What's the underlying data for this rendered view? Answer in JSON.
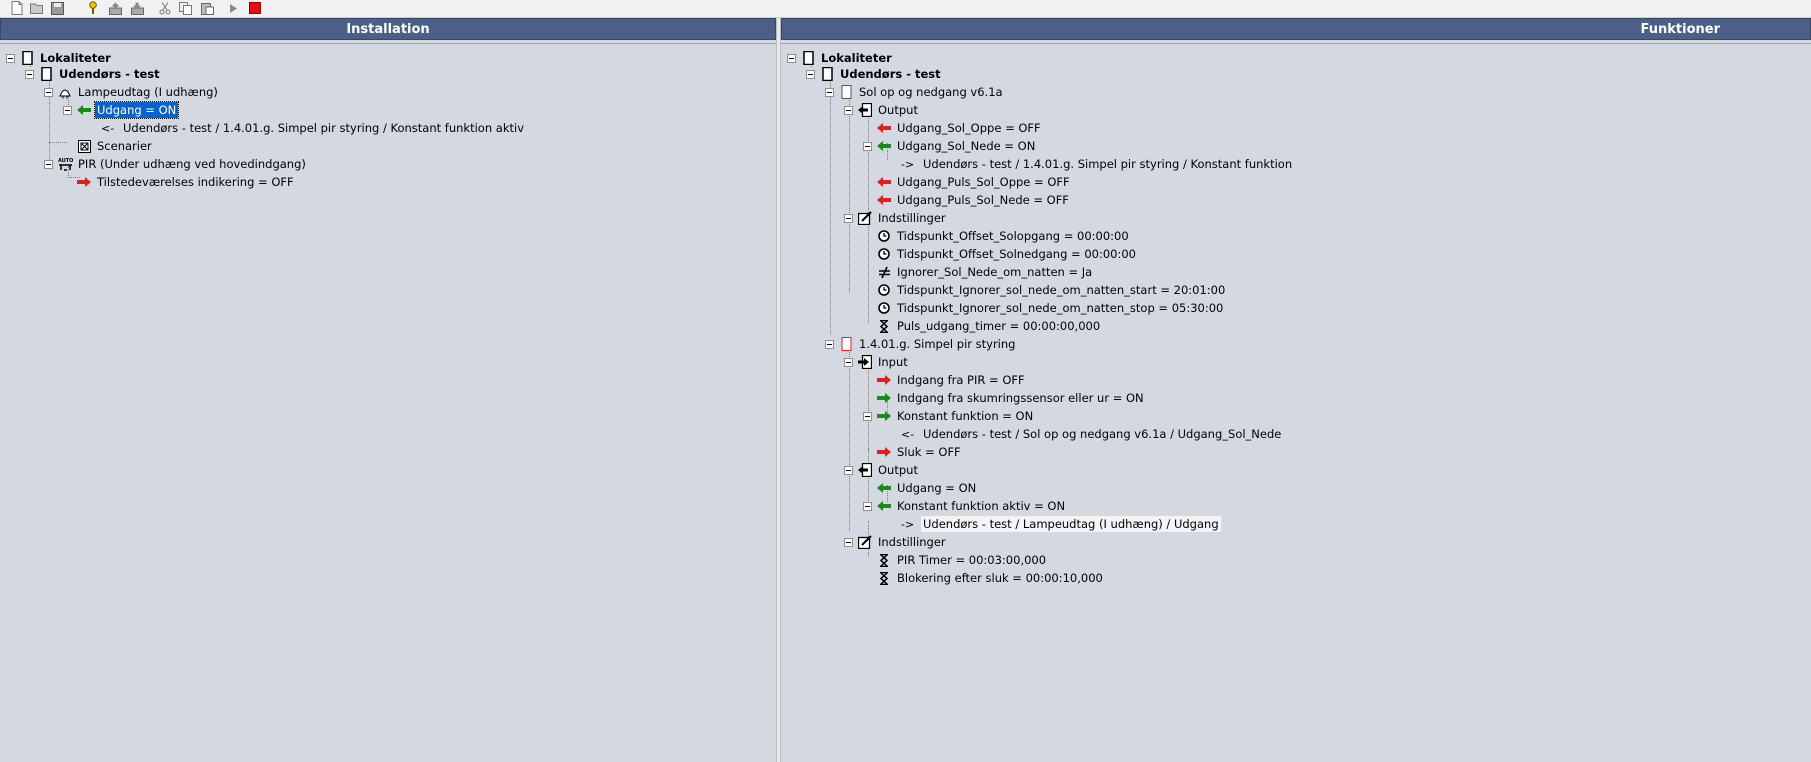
{
  "toolbar": {
    "buttons": [
      {
        "name": "new-document-icon"
      },
      {
        "name": "open-folder-icon"
      },
      {
        "name": "save-icon"
      },
      {
        "name": "key-icon"
      },
      {
        "name": "upload-icon"
      },
      {
        "name": "download-icon"
      },
      {
        "name": "cut-icon"
      },
      {
        "name": "copy-icon"
      },
      {
        "name": "paste-icon"
      },
      {
        "name": "play-icon"
      },
      {
        "name": "stop-icon"
      }
    ]
  },
  "installation": {
    "title": "Installation",
    "root": "Lokaliteter",
    "location": "Udendørs - test",
    "lamp": "Lampeudtag (I udhæng)",
    "lamp_output": "Udgang = ON",
    "lamp_output_ref_arrow": "<-",
    "lamp_output_ref": "Udendørs - test / 1.4.01.g. Simpel pir styring / Konstant funktion aktiv",
    "scenarios": "Scenarier",
    "pir": "PIR (Under udhæng ved hovedindgang)",
    "pir_output": "Tilstedeværelses indikering = OFF"
  },
  "functions": {
    "title": "Funktioner",
    "root": "Lokaliteter",
    "location": "Udendørs - test",
    "sun": {
      "name": "Sol op og nedgang v6.1a",
      "output_group": "Output",
      "outputs": [
        "Udgang_Sol_Oppe = OFF",
        "Udgang_Sol_Nede = ON",
        "Udgang_Puls_Sol_Oppe = OFF",
        "Udgang_Puls_Sol_Nede = OFF"
      ],
      "output_ref_arrow": "->",
      "output_ref": "Udendørs - test / 1.4.01.g. Simpel pir styring / Konstant funktion",
      "settings_group": "Indstillinger",
      "settings": [
        "Tidspunkt_Offset_Solopgang = 00:00:00",
        "Tidspunkt_Offset_Solnedgang = 00:00:00",
        "Ignorer_Sol_Nede_om_natten = Ja",
        "Tidspunkt_Ignorer_sol_nede_om_natten_start = 20:01:00",
        "Tidspunkt_Ignorer_sol_nede_om_natten_stop = 05:30:00",
        "Puls_udgang_timer = 00:00:00,000"
      ]
    },
    "pir": {
      "name": "1.4.01.g. Simpel pir styring",
      "input_group": "Input",
      "inputs": [
        "Indgang fra PIR = OFF",
        "Indgang fra skumringssensor eller ur = ON",
        "Konstant funktion = ON",
        "Sluk = OFF"
      ],
      "input_ref_arrow": "<-",
      "input_ref": "Udendørs - test / Sol op og nedgang v6.1a / Udgang_Sol_Nede",
      "output_group": "Output",
      "outputs": [
        "Udgang = ON",
        "Konstant funktion aktiv = ON"
      ],
      "output_ref_arrow": "->",
      "output_ref": "Udendørs - test / Lampeudtag (I udhæng)  / Udgang",
      "settings_group": "Indstillinger",
      "settings": [
        "PIR Timer = 00:03:00,000",
        "Blokering efter sluk = 00:00:10,000"
      ]
    }
  },
  "colors": {
    "header_bg": "#4c5f86",
    "panel_bg": "#d4d9e1",
    "selection": "#0a64c8",
    "output_on_arrow": "#1a8a1a",
    "output_off_arrow": "#e02020"
  }
}
